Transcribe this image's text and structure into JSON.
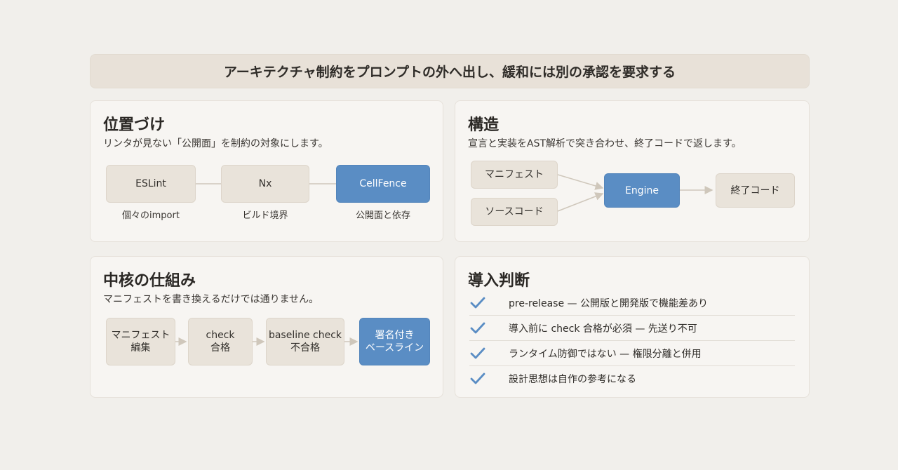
{
  "banner": "アーキテクチャ制約をプロンプトの外へ出し、緩和には別の承認を要求する",
  "positioning": {
    "title": "位置づけ",
    "subtitle": "リンタが見ない「公開面」を制約の対象にします。",
    "nodes": [
      {
        "label": "ESLint",
        "caption": "個々のimport"
      },
      {
        "label": "Nx",
        "caption": "ビルド境界"
      },
      {
        "label": "CellFence",
        "caption": "公開面と依存"
      }
    ]
  },
  "structure": {
    "title": "構造",
    "subtitle": "宣言と実装をAST解析で突き合わせ、終了コードで返します。",
    "inputs": [
      "マニフェスト",
      "ソースコード"
    ],
    "engine": "Engine",
    "output": "終了コード"
  },
  "mechanism": {
    "title": "中核の仕組み",
    "subtitle": "マニフェストを書き換えるだけでは通りません。",
    "steps": [
      {
        "line1": "マニフェスト",
        "line2": "編集"
      },
      {
        "line1": "check",
        "line2": "合格"
      },
      {
        "line1": "baseline check",
        "line2": "不合格"
      },
      {
        "line1": "署名付き",
        "line2": "ベースライン"
      }
    ]
  },
  "adoption": {
    "title": "導入判断",
    "items": [
      "pre-release — 公開版と開発版で機能差あり",
      "導入前に check 合格が必須 — 先送り不可",
      "ランタイム防御ではない — 権限分離と併用",
      "設計思想は自作の参考になる"
    ]
  },
  "colors": {
    "accent": "#5a8dc4",
    "check": "#5a8dc4",
    "node": "#e9e3da"
  }
}
